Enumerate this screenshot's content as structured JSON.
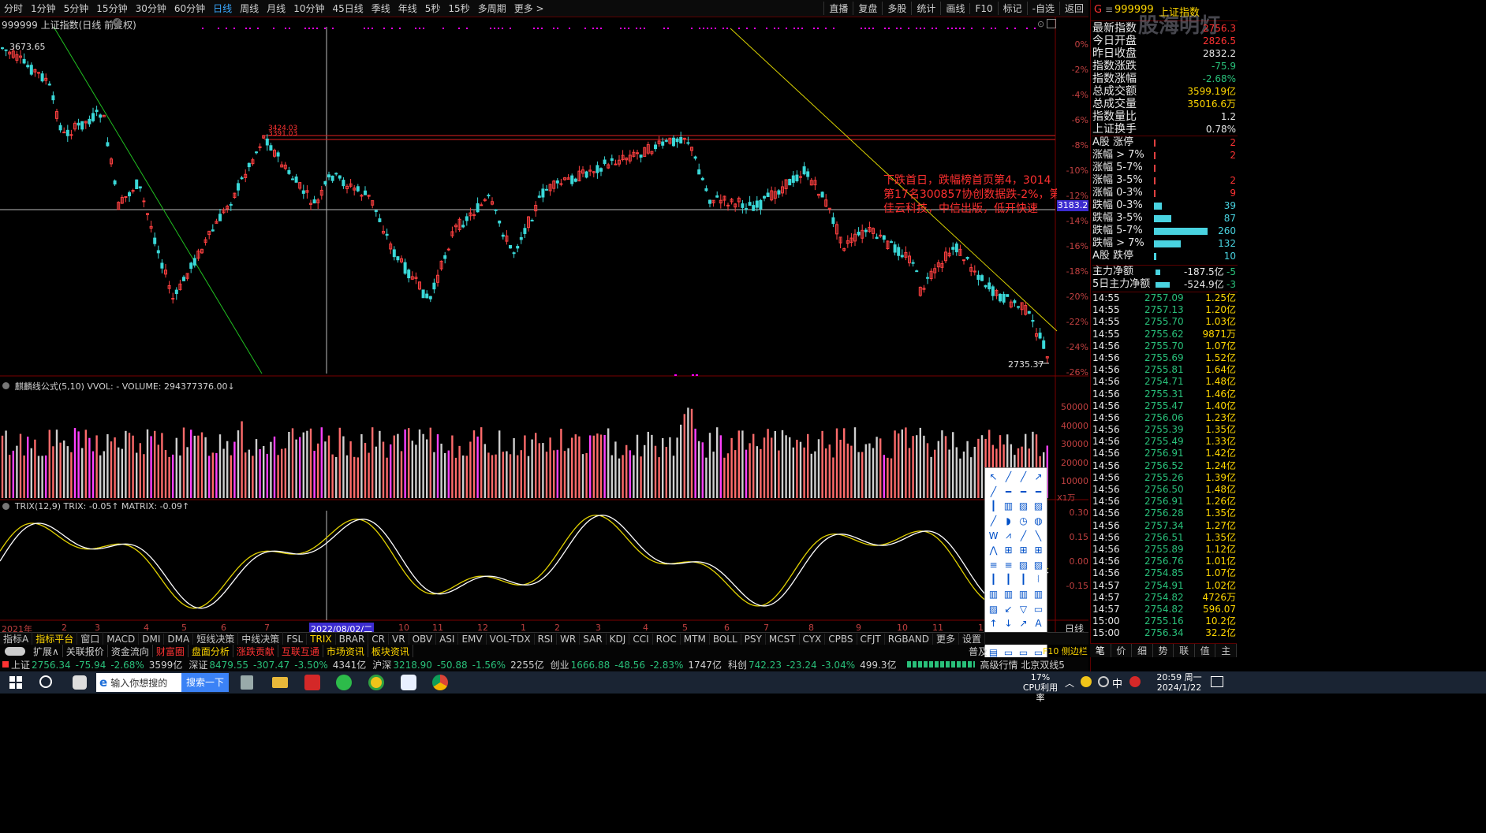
{
  "toolbar": {
    "periods": [
      "分时",
      "1分钟",
      "5分钟",
      "15分钟",
      "30分钟",
      "60分钟",
      "日线",
      "周线",
      "月线",
      "10分钟",
      "45日线",
      "季线",
      "年线",
      "5秒",
      "15秒",
      "多周期",
      "更多 >"
    ],
    "active_period": "日线",
    "right_items": [
      "直播",
      "复盘",
      "多股",
      "统计",
      "画线",
      "F10",
      "标记",
      "-自选",
      "返回"
    ]
  },
  "chart": {
    "title": "999999 上证指数(日线 前复权)",
    "high_label": "3673.65",
    "low_label": "2735.37",
    "current_price_tag": "3183.2",
    "resist_labels": [
      "3424.03",
      "3391.03"
    ],
    "pct_axis": [
      "0%",
      "-2%",
      "-4%",
      "-6%",
      "-8%",
      "-10%",
      "-12%",
      "-14%",
      "-16%",
      "-18%",
      "-20%",
      "-22%",
      "-24%",
      "-26%"
    ],
    "annotation": "下跌首日，跌幅榜首页第4，3014 第17名300857协创数据跌-2%，第 佳云科技，中信出版，低开快速",
    "annotation_lines": [
      "下跌首日，跌幅榜首页第4，3014",
      "第17名300857协创数据跌-2%，第",
      "佳云科技，中信出版，低开快速"
    ]
  },
  "volume": {
    "title": "麒麟线公式(5,10) VVOL: - VOLUME: 294377376.00↓",
    "axis": [
      "50000",
      "40000",
      "30000",
      "20000",
      "10000"
    ],
    "unit": "X1万"
  },
  "trix": {
    "title": "TRIX(12,9) TRIX: -0.05↑ MATRIX: -0.09↑",
    "axis": [
      "0.30",
      "0.15",
      "0.00",
      "-0.15"
    ]
  },
  "date_axis": {
    "labels": [
      "2021年",
      "2",
      "3",
      "4",
      "5",
      "6",
      "7",
      "2022/08/02/二",
      "10",
      "11",
      "12",
      "1",
      "2",
      "3",
      "4",
      "5",
      "6",
      "7",
      "8",
      "9",
      "10",
      "11",
      "1"
    ],
    "right_label": "日线"
  },
  "indicator_tabs": [
    "指标A",
    "指标平台",
    "窗口",
    "MACD",
    "DMI",
    "DMA",
    "短线决策",
    "中线决策",
    "FSL",
    "TRIX",
    "BRAR",
    "CR",
    "VR",
    "OBV",
    "ASI",
    "EMV",
    "VOL-TDX",
    "RSI",
    "WR",
    "SAR",
    "KDJ",
    "CCI",
    "ROC",
    "MTM",
    "BOLL",
    "PSY",
    "MCST",
    "CYX",
    "CPBS",
    "CFJT",
    "RGBAND",
    "更多",
    "设置"
  ],
  "sub_tabs": [
    "扩展∧",
    "关联报价",
    "资金流向",
    "财富圈",
    "盘面分析",
    "涨跌贡献",
    "互联互通",
    "市场资讯",
    "板块资讯"
  ],
  "status_bar": {
    "items": [
      {
        "name": "上证",
        "price": "2756.34",
        "chg": "-75.94",
        "pct": "-2.68%",
        "amt": "3599亿"
      },
      {
        "name": "深证",
        "price": "8479.55",
        "chg": "-307.47",
        "pct": "-3.50%",
        "amt": "4341亿"
      },
      {
        "name": "沪深",
        "price": "3218.90",
        "chg": "-50.88",
        "pct": "-1.56%",
        "amt": "2255亿"
      },
      {
        "name": "创业",
        "price": "1666.88",
        "chg": "-48.56",
        "pct": "-2.83%",
        "amt": "1747亿"
      },
      {
        "name": "科创",
        "price": "742.23",
        "chg": "-23.24",
        "pct": "-3.04%",
        "amt": "499.3亿"
      }
    ],
    "extra": "高级行情 北京双线5",
    "right_text": "普及",
    "f10": "F10 侧边栏 《"
  },
  "right_panel": {
    "header_code": "999999",
    "header_name": "上证指数",
    "watermark": "股海明灯",
    "stats": [
      {
        "label": "最新指数",
        "value": "2756.3",
        "color": "red"
      },
      {
        "label": "今日开盘",
        "value": "2826.5",
        "color": "red"
      },
      {
        "label": "昨日收盘",
        "value": "2832.2",
        "color": "white"
      },
      {
        "label": "指数涨跌",
        "value": "-75.9",
        "color": "green"
      },
      {
        "label": "指数涨幅",
        "value": "-2.68%",
        "color": "green"
      },
      {
        "label": "总成交额",
        "value": "3599.19亿",
        "color": "yellow"
      },
      {
        "label": "总成交量",
        "value": "35016.6万",
        "color": "yellow"
      },
      {
        "label": "指数量比",
        "value": "1.2",
        "color": "white"
      },
      {
        "label": "上证换手",
        "value": "0.78%",
        "color": "white"
      }
    ],
    "breadth": [
      {
        "label": "A股 涨停",
        "value": "2",
        "bar": 0.0,
        "color": "red"
      },
      {
        "label": "涨幅 > 7%",
        "value": "2",
        "bar": 0.0,
        "color": "red"
      },
      {
        "label": "涨幅 5-7%",
        "value": "",
        "bar": 0.0,
        "color": "red"
      },
      {
        "label": "涨幅 3-5%",
        "value": "2",
        "bar": 0.0,
        "color": "red"
      },
      {
        "label": "涨幅 0-3%",
        "value": "9",
        "bar": 0.0,
        "color": "red"
      },
      {
        "label": "跌幅 0-3%",
        "value": "39",
        "bar": 0.15,
        "color": "cyan"
      },
      {
        "label": "跌幅 3-5%",
        "value": "87",
        "bar": 0.33,
        "color": "cyan"
      },
      {
        "label": "跌幅 5-7%",
        "value": "260",
        "bar": 1.0,
        "color": "cyan"
      },
      {
        "label": "跌幅 > 7%",
        "value": "132",
        "bar": 0.5,
        "color": "cyan"
      },
      {
        "label": "A股 跌停",
        "value": "10",
        "bar": 0.04,
        "color": "cyan"
      }
    ],
    "flows": [
      {
        "label": "主力净额",
        "value": "-187.5亿",
        "extra": "-5"
      },
      {
        "label": "5日主力净额",
        "value": "-524.9亿",
        "extra": "-3"
      }
    ],
    "ticks": [
      {
        "time": "14:55",
        "price": "2757.09",
        "vol": "1.25亿"
      },
      {
        "time": "14:55",
        "price": "2757.13",
        "vol": "1.20亿"
      },
      {
        "time": "14:55",
        "price": "2755.70",
        "vol": "1.03亿"
      },
      {
        "time": "14:55",
        "price": "2755.62",
        "vol": "9871万"
      },
      {
        "time": "14:56",
        "price": "2755.70",
        "vol": "1.07亿"
      },
      {
        "time": "14:56",
        "price": "2755.69",
        "vol": "1.52亿"
      },
      {
        "time": "14:56",
        "price": "2755.81",
        "vol": "1.64亿"
      },
      {
        "time": "14:56",
        "price": "2754.71",
        "vol": "1.48亿"
      },
      {
        "time": "14:56",
        "price": "2755.31",
        "vol": "1.46亿"
      },
      {
        "time": "14:56",
        "price": "2755.47",
        "vol": "1.40亿"
      },
      {
        "time": "14:56",
        "price": "2756.06",
        "vol": "1.23亿"
      },
      {
        "time": "14:56",
        "price": "2755.39",
        "vol": "1.35亿"
      },
      {
        "time": "14:56",
        "price": "2755.49",
        "vol": "1.33亿"
      },
      {
        "time": "14:56",
        "price": "2756.91",
        "vol": "1.42亿"
      },
      {
        "time": "14:56",
        "price": "2756.52",
        "vol": "1.24亿"
      },
      {
        "time": "14:56",
        "price": "2755.26",
        "vol": "1.39亿"
      },
      {
        "time": "14:56",
        "price": "2756.50",
        "vol": "1.48亿"
      },
      {
        "time": "14:56",
        "price": "2756.91",
        "vol": "1.26亿"
      },
      {
        "time": "14:56",
        "price": "2756.28",
        "vol": "1.35亿"
      },
      {
        "time": "14:56",
        "price": "2757.34",
        "vol": "1.27亿"
      },
      {
        "time": "14:56",
        "price": "2756.51",
        "vol": "1.35亿"
      },
      {
        "time": "14:56",
        "price": "2755.89",
        "vol": "1.12亿"
      },
      {
        "time": "14:56",
        "price": "2756.76",
        "vol": "1.01亿"
      },
      {
        "time": "14:56",
        "price": "2754.85",
        "vol": "1.07亿"
      },
      {
        "time": "14:57",
        "price": "2754.91",
        "vol": "1.02亿"
      },
      {
        "time": "14:57",
        "price": "2754.82",
        "vol": "4726万"
      },
      {
        "time": "14:57",
        "price": "2754.82",
        "vol": "596.07"
      },
      {
        "time": "15:00",
        "price": "2755.16",
        "vol": "10.2亿"
      },
      {
        "time": "15:00",
        "price": "2756.34",
        "vol": "32.2亿"
      }
    ],
    "bottom_tabs": [
      "笔",
      "价",
      "细",
      "势",
      "联",
      "值",
      "主"
    ]
  },
  "taskbar": {
    "search_placeholder": "输入你想搜的",
    "search_button": "搜索一下",
    "cpu": "17%",
    "cpu_label": "CPU利用率",
    "time": "20:59 周一",
    "date": "2024/1/22",
    "ime": "中"
  },
  "colors": {
    "up": "#ff3333",
    "down": "#29c07a",
    "accent": "#3aa8ff",
    "yellow": "#ffd700",
    "magenta": "#ff00ff",
    "cyan": "#49d3e0"
  }
}
